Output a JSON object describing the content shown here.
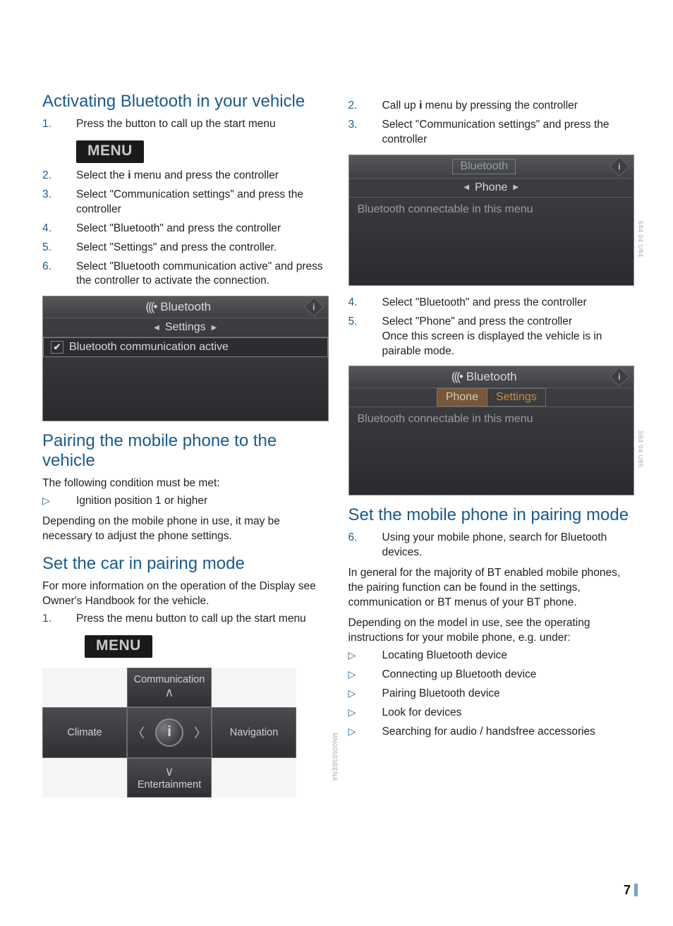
{
  "page_number": "7",
  "menu_label": "MENU",
  "left": {
    "sec1": {
      "title": "Activating Bluetooth in your vehicle",
      "steps": [
        {
          "n": "1.",
          "t": "Press the button to call up the start menu"
        },
        {
          "n": "2.",
          "t": "Select the i menu and press the controller"
        },
        {
          "n": "3.",
          "t": "Select \"Communication settings\" and press the controller"
        },
        {
          "n": "4.",
          "t": "Select \"Bluetooth\" and press the controller"
        },
        {
          "n": "5.",
          "t": "Select \"Settings\" and press the controller."
        },
        {
          "n": "6.",
          "t": "Select \"Bluetooth communication active\" and press the controller to activate the connection."
        }
      ]
    },
    "fig1": {
      "header": "Bluetooth",
      "sub": "Settings",
      "row1": "Bluetooth communication active"
    },
    "sec2": {
      "title": "Pairing the mobile phone to the vehicle",
      "p1": "The following condition must be met:",
      "b1": "Ignition position 1 or higher",
      "p2": "Depending on the mobile phone in use, it may be necessary to adjust the phone settings."
    },
    "sec3": {
      "title": "Set the car in pairing mode",
      "p1": "For more information on the operation of the Display see Owner's Handbook for the vehicle.",
      "steps": [
        {
          "n": "1.",
          "t": "Press the menu button to call up the start menu"
        }
      ]
    },
    "idrive": {
      "top": "Communication",
      "left": "Climate",
      "right": "Navigation",
      "bottom": "Entertainment",
      "label": "MN00503BENA"
    }
  },
  "right": {
    "sec1": {
      "steps": [
        {
          "n": "2.",
          "t": "Call up i menu by pressing the controller"
        },
        {
          "n": "3.",
          "t": "Select  \"Communication settings\" and press the controller"
        }
      ]
    },
    "fig1": {
      "header": "Bluetooth",
      "sub": "Phone",
      "msg": "Bluetooth connectable in this menu",
      "label": "S84 04 U84"
    },
    "sec2": {
      "steps": [
        {
          "n": "4.",
          "t": "Select \"Bluetooth\" and press the controller"
        },
        {
          "n": "5.",
          "t": "Select \"Phone\" and press the controller\nOnce this screen is displayed the vehicle is in pairable mode."
        }
      ]
    },
    "fig2": {
      "header": "Bluetooth",
      "tab_active": "Phone",
      "tab_inactive": "Settings",
      "msg": "Bluetooth connectable in this menu",
      "label": "S84 04 U85"
    },
    "sec3": {
      "title": "Set the mobile phone in pairing mode",
      "steps": [
        {
          "n": "6.",
          "t": "Using your mobile phone, search for Bluetooth devices."
        }
      ],
      "p1": "In general for the majority of BT enabled mobile phones, the pairing function can be found in the settings, communication or BT menus of your BT phone.",
      "p2": "Depending on the model in use, see the operating instructions for your mobile phone, e.g. under:",
      "bullets": [
        "Locating Bluetooth device",
        "Connecting up Bluetooth device",
        "Pairing Bluetooth device",
        "Look for devices",
        "Searching for audio / handsfree accessories"
      ]
    }
  }
}
